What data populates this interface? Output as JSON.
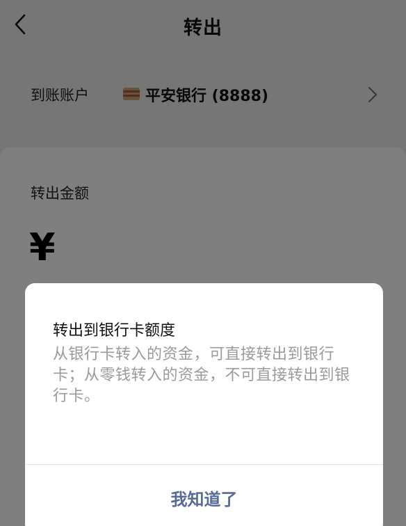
{
  "navbar": {
    "title": "转出",
    "back_icon": "chevron-left-icon"
  },
  "account": {
    "label": "到账账户",
    "bank_icon": "bank-card-icon",
    "bank_name": "平安银行 (8888)",
    "arrow_icon": "chevron-right-icon"
  },
  "amount": {
    "label": "转出金额",
    "currency_symbol": "¥"
  },
  "dialog": {
    "title": "转出到银行卡额度",
    "body": "从银行卡转入的资金，可直接转出到银行卡；从零钱转入的资金，不可直接转出到银行卡。",
    "confirm_label": "我知道了"
  },
  "colors": {
    "page_bg": "#ededed",
    "dialog_button": "#576b95",
    "body_text": "#9a9a9a"
  }
}
